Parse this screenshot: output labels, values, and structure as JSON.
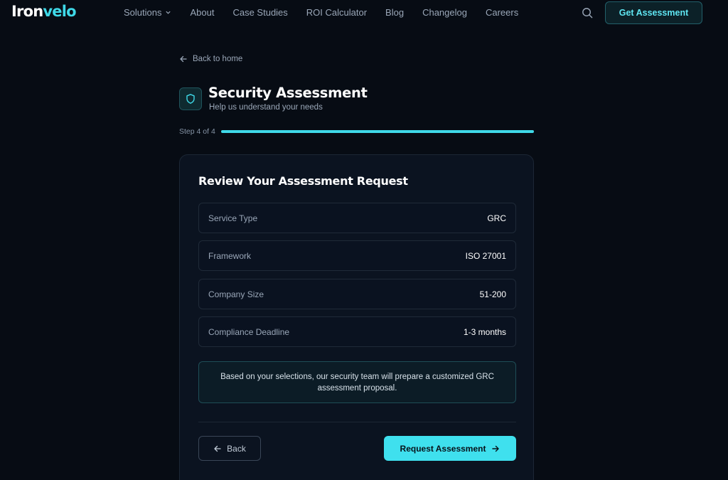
{
  "brand": {
    "name_part1": "Iron",
    "name_part2": "velo",
    "accent": "#3fd9e8"
  },
  "nav": {
    "links": [
      "Solutions",
      "About",
      "Case Studies",
      "ROI Calculator",
      "Blog",
      "Changelog",
      "Careers"
    ],
    "search_icon": "search-icon",
    "cta_label": "Get Assessment"
  },
  "back_home_label": "Back to home",
  "header": {
    "icon": "shield-icon",
    "title": "Security Assessment",
    "subtitle": "Help us understand your needs"
  },
  "progress": {
    "step_text": "Step 4 of 4",
    "fraction": 1.0
  },
  "review": {
    "title": "Review Your Assessment Request",
    "rows": [
      {
        "label": "Service Type",
        "value": "GRC"
      },
      {
        "label": "Framework",
        "value": "ISO 27001"
      },
      {
        "label": "Company Size",
        "value": "51-200"
      },
      {
        "label": "Compliance Deadline",
        "value": "1-3 months"
      }
    ],
    "note": "Based on your selections, our security team will prepare a customized GRC assessment proposal.",
    "back_label": "Back",
    "submit_label": "Request Assessment"
  }
}
